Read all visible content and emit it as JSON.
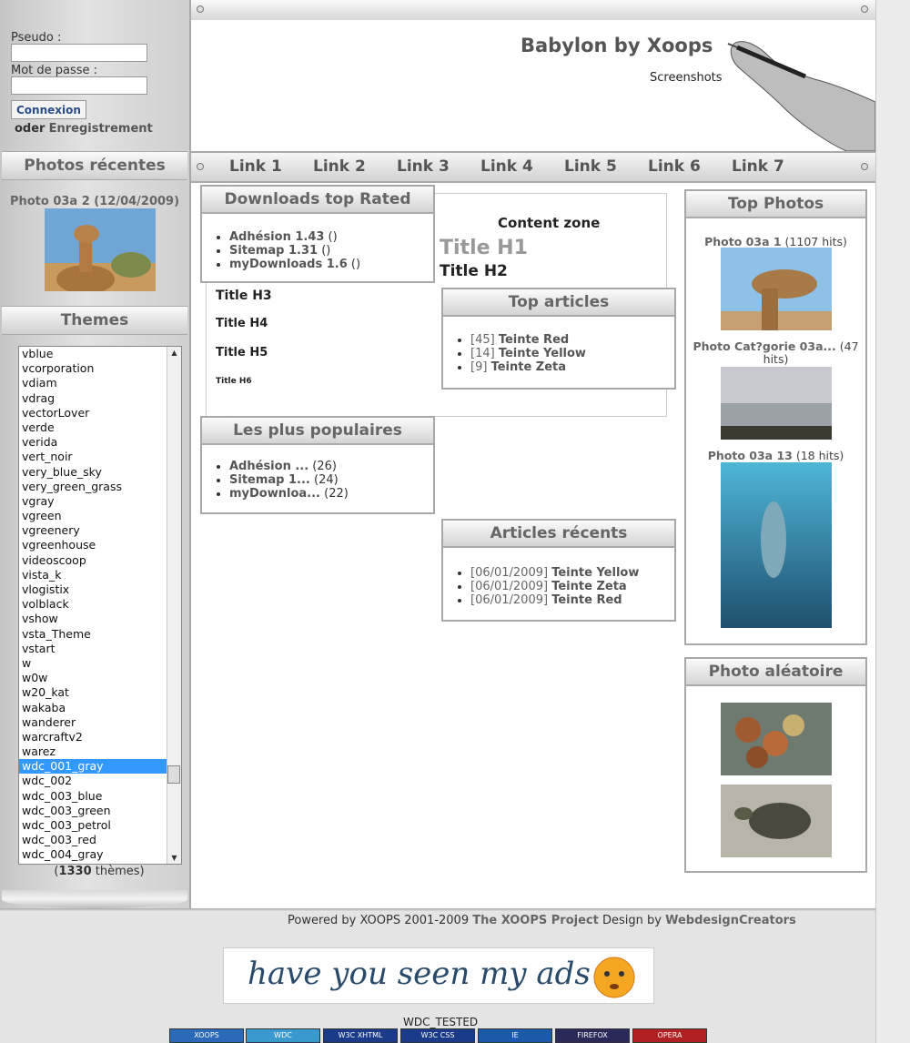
{
  "login": {
    "pseudo_label": "Pseudo :",
    "password_label": "Mot de passe :",
    "connexion_button": "Connexion",
    "or_text": "oder",
    "register_link": "Enregistrement"
  },
  "header": {
    "site_title": "Babylon by Xoops",
    "slogan": "Screenshots"
  },
  "nav": {
    "links": [
      "Link 1",
      "Link 2",
      "Link 3",
      "Link 4",
      "Link 5",
      "Link 6",
      "Link 7"
    ]
  },
  "recent_photos": {
    "title": "Photos récentes",
    "caption": "Photo 03a 2 (12/04/2009)"
  },
  "themes": {
    "title": "Themes",
    "items": [
      "vblue",
      "vcorporation",
      "vdiam",
      "vdrag",
      "vectorLover",
      "verde",
      "verida",
      "vert_noir",
      "very_blue_sky",
      "very_green_grass",
      "vgray",
      "vgreen",
      "vgreenery",
      "vgreenhouse",
      "videoscoop",
      "vista_k",
      "vlogistix",
      "volblack",
      "vshow",
      "vsta_Theme",
      "vstart",
      "w",
      "w0w",
      "w20_kat",
      "wakaba",
      "wanderer",
      "warcraftv2",
      "warez",
      "wdc_001_gray",
      "wdc_002",
      "wdc_003_blue",
      "wdc_003_green",
      "wdc_003_petrol",
      "wdc_003_red",
      "wdc_004_gray"
    ],
    "selected": "wdc_001_gray",
    "count_open": "(",
    "count": "1330",
    "count_suffix": " thèmes)"
  },
  "downloads_top": {
    "title": "Downloads top Rated",
    "items": [
      {
        "name": "Adhésion 1.43",
        "extra": " ()"
      },
      {
        "name": "Sitemap 1.31",
        "extra": " ()"
      },
      {
        "name": "myDownloads 1.6",
        "extra": " ()"
      }
    ]
  },
  "content_zone": {
    "title": "Content zone",
    "h1": "Title H1",
    "h2": "Title H2",
    "h3": "Title H3",
    "h4": "Title H4",
    "h5": "Title H5",
    "h6": "Title H6"
  },
  "top_articles": {
    "title": "Top articles",
    "items": [
      {
        "count": "[45]",
        "name": "Teinte Red"
      },
      {
        "count": "[14]",
        "name": "Teinte Yellow"
      },
      {
        "count": "[9]",
        "name": "Teinte Zeta"
      }
    ]
  },
  "popular": {
    "title": "Les plus populaires",
    "items": [
      {
        "name": "Adhésion ...",
        "extra": " (26)"
      },
      {
        "name": "Sitemap 1...",
        "extra": " (24)"
      },
      {
        "name": "myDownloa...",
        "extra": " (22)"
      }
    ]
  },
  "recent_articles": {
    "title": "Articles récents",
    "items": [
      {
        "date": "[06/01/2009]",
        "name": "Teinte Yellow"
      },
      {
        "date": "[06/01/2009]",
        "name": "Teinte Zeta"
      },
      {
        "date": "[06/01/2009]",
        "name": "Teinte Red"
      }
    ]
  },
  "top_photos": {
    "title": "Top Photos",
    "items": [
      {
        "name": "Photo 03a 1",
        "hits": " (1107 hits)"
      },
      {
        "name": "Photo Cat?gorie 03a...",
        "hits": " (47 hits)"
      },
      {
        "name": "Photo 03a 13",
        "hits": " (18 hits)"
      }
    ]
  },
  "random_photo": {
    "title": "Photo aléatoire"
  },
  "footer": {
    "powered": "Powered by XOOPS 2001-2009 ",
    "project": "The XOOPS Project",
    "design_by": " Design by ",
    "designer": "WebdesignCreators",
    "ad_text": "have you seen my ads ?",
    "tested": "WDC_TESTED",
    "badges": [
      "XOOPS",
      "WDC",
      "W3C XHTML",
      "W3C CSS",
      "IE",
      "FIREFOX",
      "OPERA"
    ]
  }
}
